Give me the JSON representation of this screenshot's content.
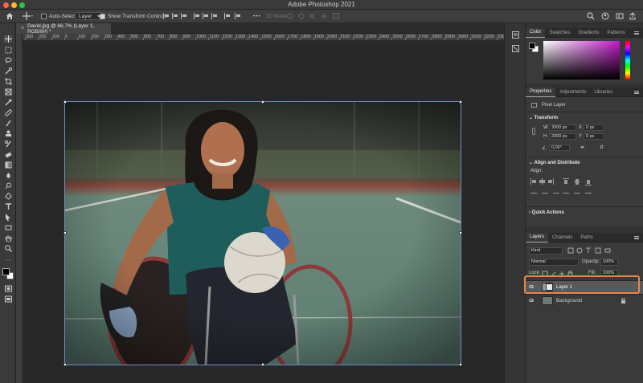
{
  "window": {
    "title": "Adobe Photoshop 2021"
  },
  "options_bar": {
    "auto_select_label": "Auto-Select:",
    "auto_select_target": "Layer",
    "show_transform_label": "Show Transform Controls",
    "mode_label": "3D Mode:"
  },
  "document": {
    "tab_label": "David.jpg @ 66,7% (Layer 1, RGB/8#) *"
  },
  "ruler": {
    "h_labels": [
      "300",
      "200",
      "100",
      "0",
      "100",
      "200",
      "300",
      "400",
      "500",
      "600",
      "700",
      "800",
      "900",
      "1000",
      "1100",
      "1200",
      "1300",
      "1400",
      "1500",
      "1600",
      "1700",
      "1800",
      "1900",
      "2000",
      "2100",
      "2200",
      "2300",
      "2400",
      "2500",
      "2600",
      "2700",
      "2800",
      "2900",
      "3000",
      "3100",
      "3200",
      "3300"
    ]
  },
  "panels": {
    "color_tabs": [
      "Color",
      "Swatches",
      "Gradients",
      "Patterns"
    ],
    "properties_tabs": [
      "Properties",
      "Adjustments",
      "Libraries"
    ],
    "properties": {
      "kind": "Pixel Layer",
      "transform_title": "Transform",
      "w_label": "W",
      "w_value": "3000 px",
      "h_label": "H",
      "h_value": "2000 px",
      "x_label": "X",
      "x_value": "0 px",
      "y_label": "Y",
      "y_value": "0 px",
      "angle_value": "0,00°",
      "align_title": "Align and Distribute",
      "align_label": "Align:",
      "quick_actions_title": "Quick Actions"
    },
    "layers_tabs": [
      "Layers",
      "Channels",
      "Paths"
    ],
    "layers": {
      "kind_filter": "Kind",
      "blend_mode": "Normal",
      "opacity_label": "Opacity:",
      "opacity_value": "100%",
      "lock_label": "Lock:",
      "fill_label": "Fill:",
      "fill_value": "100%",
      "items": [
        {
          "name": "Layer 1",
          "selected": true
        },
        {
          "name": "Background",
          "selected": false
        }
      ]
    }
  },
  "colors": {
    "highlight": "#e8864a",
    "selection": "#6b8fc7"
  }
}
